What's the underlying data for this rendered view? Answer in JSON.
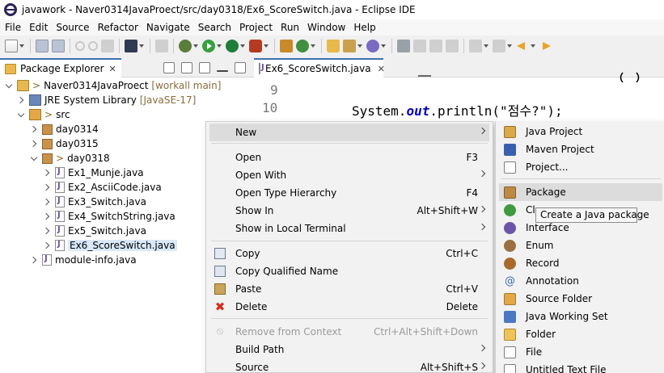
{
  "window": {
    "title": "javawork - Naver0314JavaProect/src/day0318/Ex6_ScoreSwitch.java - Eclipse IDE"
  },
  "menubar": [
    "File",
    "Edit",
    "Source",
    "Refactor",
    "Navigate",
    "Search",
    "Project",
    "Run",
    "Window",
    "Help"
  ],
  "package_explorer": {
    "tab_label": "Package Explorer",
    "tree": [
      {
        "name": "Naver0314JavaProect",
        "prefix": ">",
        "annotation": "[workall main]",
        "expanded": true,
        "icon": "project-icon"
      },
      {
        "name": "JRE System Library",
        "annotation": "[JavaSE-17]",
        "expanded": false,
        "icon": "library-icon"
      },
      {
        "name": "src",
        "prefix": ">",
        "expanded": true,
        "icon": "source-folder-icon"
      },
      {
        "name": "day0314",
        "expanded": false,
        "icon": "package-icon"
      },
      {
        "name": "day0315",
        "expanded": false,
        "icon": "package-icon"
      },
      {
        "name": "day0318",
        "prefix": ">",
        "expanded": true,
        "icon": "package-icon"
      },
      {
        "name": "Ex1_Munje.java",
        "expanded": false,
        "icon": "java-file-icon"
      },
      {
        "name": "Ex2_AsciiCode.java",
        "expanded": false,
        "icon": "java-file-icon"
      },
      {
        "name": "Ex3_Switch.java",
        "expanded": false,
        "icon": "java-file-icon"
      },
      {
        "name": "Ex4_SwitchString.java",
        "expanded": false,
        "icon": "java-file-icon"
      },
      {
        "name": "Ex5_Switch.java",
        "expanded": false,
        "icon": "java-file-icon"
      },
      {
        "name": "Ex6_ScoreSwitch.java",
        "expanded": false,
        "selected": true,
        "icon": "java-file-icon"
      },
      {
        "name": "module-info.java",
        "expanded": false,
        "icon": "java-file-icon"
      }
    ]
  },
  "editor": {
    "tab_label": "Ex6_ScoreSwitch.java",
    "lines": [
      {
        "num": "9",
        "prefix": "",
        "keyword": "",
        "rest": ""
      },
      {
        "num": "10",
        "prefix": "System.",
        "keyword": "out",
        "rest": ".println(",
        "string": "\"점수?\"",
        "suffix": ");"
      }
    ]
  },
  "context_menu": {
    "items": [
      {
        "label": "New",
        "shortcut": "",
        "submenu": true,
        "highlighted": true,
        "icon": ""
      },
      {
        "label": "Open",
        "shortcut": "F3",
        "icon": ""
      },
      {
        "label": "Open With",
        "shortcut": "",
        "submenu": true,
        "icon": ""
      },
      {
        "label": "Open Type Hierarchy",
        "shortcut": "F4",
        "icon": ""
      },
      {
        "label": "Show In",
        "shortcut": "Alt+Shift+W",
        "submenu": true,
        "icon": ""
      },
      {
        "label": "Show in Local Terminal",
        "shortcut": "",
        "submenu": true,
        "icon": ""
      },
      {
        "label": "Copy",
        "shortcut": "Ctrl+C",
        "icon": "copy-icon"
      },
      {
        "label": "Copy Qualified Name",
        "shortcut": "",
        "icon": "copy-qualified-name-icon"
      },
      {
        "label": "Paste",
        "shortcut": "Ctrl+V",
        "icon": "paste-icon"
      },
      {
        "label": "Delete",
        "shortcut": "Delete",
        "icon": "delete-icon"
      },
      {
        "label": "Remove from Context",
        "shortcut": "Ctrl+Alt+Shift+Down",
        "disabled": true,
        "icon": "remove-from-context-icon"
      },
      {
        "label": "Build Path",
        "shortcut": "",
        "submenu": true,
        "icon": ""
      },
      {
        "label": "Source",
        "shortcut": "Alt+Shift+S",
        "submenu": true,
        "icon": ""
      }
    ]
  },
  "new_submenu": {
    "items": [
      {
        "label": "Java Project",
        "icon": "java-project-icon"
      },
      {
        "label": "Maven Project",
        "icon": "maven-project-icon"
      },
      {
        "label": "Project...",
        "icon": "project-icon"
      },
      {
        "label": "Package",
        "icon": "package-icon",
        "highlighted": true
      },
      {
        "label": "Cl",
        "icon": "class-icon"
      },
      {
        "label": "Interface",
        "icon": "interface-icon"
      },
      {
        "label": "Enum",
        "icon": "enum-icon"
      },
      {
        "label": "Record",
        "icon": "record-icon"
      },
      {
        "label": "Annotation",
        "icon": "annotation-icon"
      },
      {
        "label": "Source Folder",
        "icon": "source-folder-icon"
      },
      {
        "label": "Java Working Set",
        "icon": "java-working-set-icon"
      },
      {
        "label": "Folder",
        "icon": "folder-icon"
      },
      {
        "label": "File",
        "icon": "file-icon"
      },
      {
        "label": "Untitled Text File",
        "icon": "text-file-icon"
      }
    ]
  },
  "tooltip": {
    "text": "Create a Java package"
  }
}
